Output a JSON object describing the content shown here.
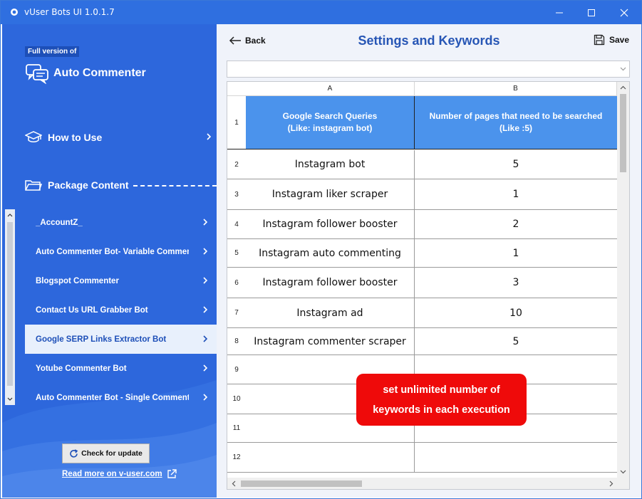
{
  "window": {
    "title": "vUser Bots UI 1.0.1.7",
    "controls": [
      "minimize",
      "maximize",
      "close"
    ]
  },
  "sidebar": {
    "badge": "Full version of",
    "brand": "Auto Commenter",
    "how_to_use": "How to Use",
    "package_content": "Package Content",
    "items": [
      {
        "label": "_AccountZ_",
        "active": false
      },
      {
        "label": "Auto Commenter Bot- Variable Comment V",
        "active": false
      },
      {
        "label": "Blogspot Commenter",
        "active": false
      },
      {
        "label": "Contact Us URL Grabber Bot",
        "active": false
      },
      {
        "label": "Google SERP Links Extractor Bot",
        "active": true
      },
      {
        "label": "Yotube Commenter Bot",
        "active": false
      },
      {
        "label": "Auto Commenter Bot - Single Comment",
        "active": false
      }
    ],
    "check_update": "Check for update",
    "read_more": "Read more on v-user.com"
  },
  "main": {
    "back": "Back",
    "title": "Settings and Keywords",
    "save": "Save",
    "combo_value": "",
    "grid": {
      "columns": [
        "A",
        "B"
      ],
      "header_row": {
        "num": "1",
        "a_line1": "Google Search Queries",
        "a_line2": "(Like: instagram bot)",
        "b_line1": "Number of pages that need to be searched",
        "b_line2": "(Like :5)"
      },
      "rows": [
        {
          "num": "2",
          "query": "Instagram bot",
          "pages": "5"
        },
        {
          "num": "3",
          "query": "Instagram liker scraper",
          "pages": "1"
        },
        {
          "num": "4",
          "query": "Instagram follower booster",
          "pages": "2"
        },
        {
          "num": "5",
          "query": "Instagram auto commenting",
          "pages": "1"
        },
        {
          "num": "6",
          "query": "Instagram follower booster",
          "pages": "3"
        },
        {
          "num": "7",
          "query": "Instagram ad",
          "pages": "10"
        },
        {
          "num": "8",
          "query": "Instagram commenter scraper",
          "pages": "5"
        },
        {
          "num": "9",
          "query": "",
          "pages": ""
        },
        {
          "num": "10",
          "query": "",
          "pages": ""
        },
        {
          "num": "11",
          "query": "",
          "pages": ""
        },
        {
          "num": "12",
          "query": "",
          "pages": ""
        }
      ]
    },
    "callout": {
      "line1": "set unlimited number of",
      "line2": "keywords in each execution"
    }
  },
  "colors": {
    "titlebar": "#2f6fe0",
    "sidebar": "#2d67dc",
    "grid_header": "#4b93ec",
    "callout": "#ef0a0a",
    "title_text": "#2756b5"
  },
  "icons": [
    "app-icon",
    "chat-bubbles-icon",
    "graduation-cap-icon",
    "folder-icon",
    "chevron-right-icon",
    "refresh-icon",
    "external-link-icon",
    "arrow-left-icon",
    "save-disk-icon",
    "chevron-down-icon"
  ]
}
